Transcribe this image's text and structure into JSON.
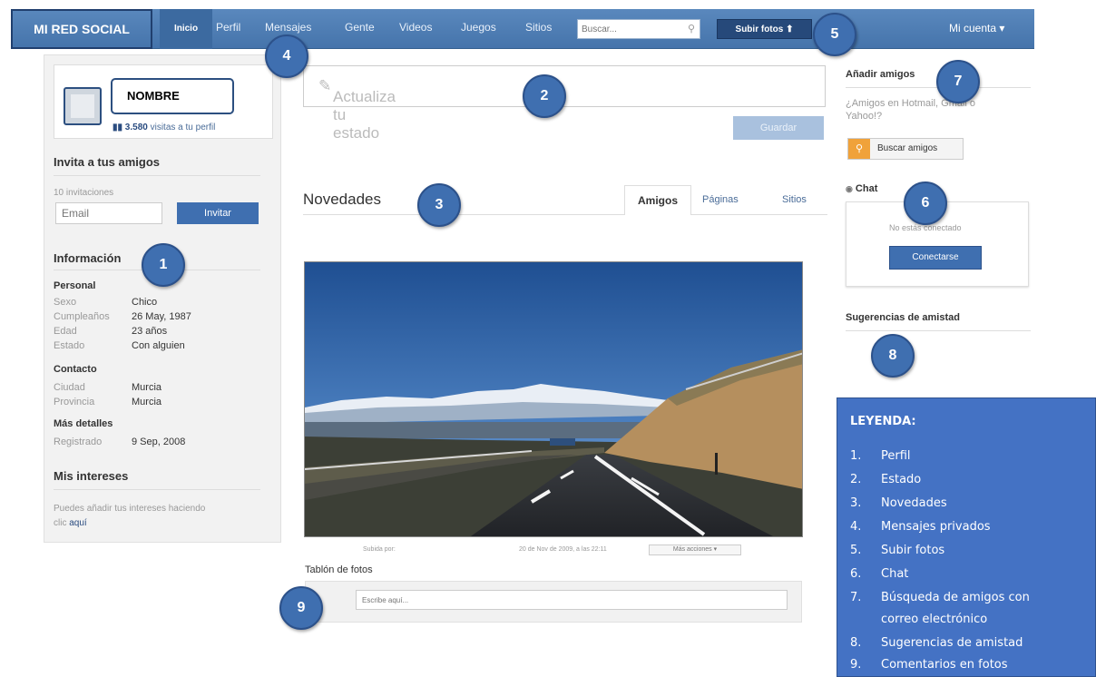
{
  "nav": {
    "brand": "MI RED SOCIAL",
    "items": [
      "Inicio",
      "Perfil",
      "Mensajes",
      "Gente",
      "Videos",
      "Juegos",
      "Sitios"
    ],
    "search_placeholder": "Buscar...",
    "upload_label": "Subir fotos ⬆",
    "account_label": "Mi cuenta ▾"
  },
  "profile": {
    "name_placeholder": "NOMBRE",
    "visits_count": "3.580",
    "visits_label": "visitas a tu perfil"
  },
  "invite": {
    "title": "Invita a tus amigos",
    "invitations": "10 invitaciones",
    "email_placeholder": "Email",
    "button": "Invitar"
  },
  "info": {
    "title": "Información",
    "personal_title": "Personal",
    "personal": [
      {
        "k": "Sexo",
        "v": "Chico"
      },
      {
        "k": "Cumpleaños",
        "v": "26 May, 1987"
      },
      {
        "k": "Edad",
        "v": "23 años"
      },
      {
        "k": "Estado",
        "v": "Con alguien"
      }
    ],
    "contact_title": "Contacto",
    "contact": [
      {
        "k": "Ciudad",
        "v": "Murcia"
      },
      {
        "k": "Provincia",
        "v": "Murcia"
      }
    ],
    "details_title": "Más detalles",
    "details": [
      {
        "k": "Registrado",
        "v": "9 Sep, 2008"
      }
    ],
    "interests_title": "Mis intereses",
    "interests_text": "Puedes añadir tus intereses haciendo",
    "interests_text2": "clic",
    "interests_link": "aquí"
  },
  "status": {
    "placeholder": "Actualiza tu estado",
    "save": "Guardar"
  },
  "news": {
    "title": "Novedades",
    "tabs": [
      "Amigos",
      "Páginas",
      "Sitios"
    ]
  },
  "photo": {
    "caption_left": "Subida por:",
    "caption_right": "20 de Nov de 2009, a las 22:11",
    "more_actions": "Más acciones ▾"
  },
  "wall": {
    "title": "Tablón de fotos",
    "placeholder": "Escribe aquí..."
  },
  "right": {
    "add_friends_title": "Añadir amigos",
    "add_friends_text1": "¿Amigos en Hotmail, Gmail o",
    "add_friends_text2": "Yahoo!?",
    "find_button": "Buscar amigos",
    "chat_title": "Chat",
    "chat_status": "No estás conectado",
    "connect_button": "Conectarse",
    "suggestions_title": "Sugerencias de amistad"
  },
  "badges": [
    "1",
    "2",
    "3",
    "4",
    "5",
    "6",
    "7",
    "8",
    "9"
  ],
  "legend": {
    "title": "LEYENDA:",
    "items": [
      {
        "n": "1.",
        "t": "Perfil"
      },
      {
        "n": "2.",
        "t": "Estado"
      },
      {
        "n": "3.",
        "t": "Novedades"
      },
      {
        "n": "4.",
        "t": "Mensajes privados"
      },
      {
        "n": "5.",
        "t": "Subir fotos"
      },
      {
        "n": "6.",
        "t": "Chat"
      },
      {
        "n": "7.",
        "t": "Búsqueda de amigos con"
      },
      {
        "n": "",
        "t": "correo electrónico"
      },
      {
        "n": "8.",
        "t": "Sugerencias de amistad"
      },
      {
        "n": "9.",
        "t": "Comentarios en fotos"
      }
    ]
  },
  "colors": {
    "nav_blue": "#4f7fb8",
    "badge_blue": "#3f6fb0",
    "legend_blue": "#4472c4"
  }
}
